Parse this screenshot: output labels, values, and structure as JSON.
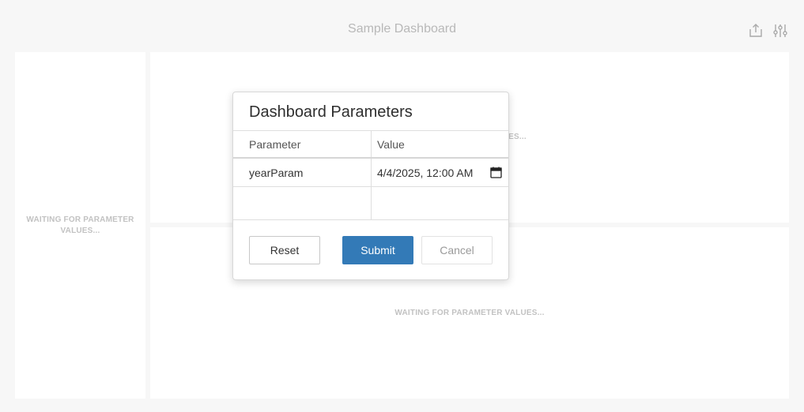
{
  "header": {
    "title": "Sample Dashboard",
    "export_icon": "export-icon",
    "parameters_icon": "parameters-icon"
  },
  "panels": {
    "left_message": "WAITING FOR PARAMETER VALUES...",
    "top_message_partial": "ALUES...",
    "bottom_message": "WAITING FOR PARAMETER VALUES..."
  },
  "dialog": {
    "title": "Dashboard Parameters",
    "columns": {
      "parameter": "Parameter",
      "value": "Value"
    },
    "rows": [
      {
        "parameter": "yearParam",
        "value": "4/4/2025, 12:00 AM",
        "icon": "calendar-icon"
      }
    ],
    "buttons": {
      "reset": "Reset",
      "submit": "Submit",
      "cancel": "Cancel"
    }
  },
  "colors": {
    "background": "#f7f7f7",
    "panel": "#ffffff",
    "accent": "#337ab7",
    "muted_text": "#c2c2c2"
  }
}
